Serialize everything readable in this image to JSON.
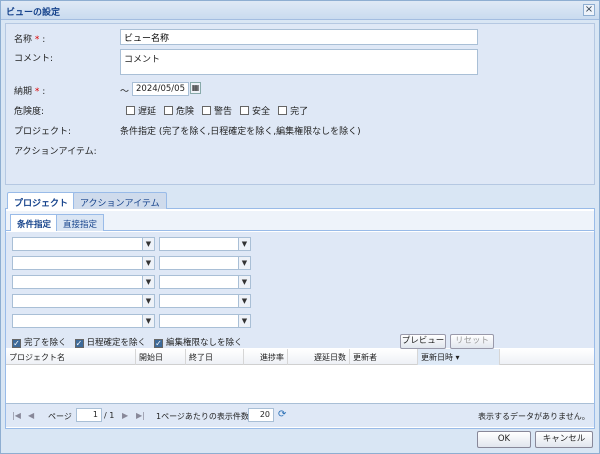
{
  "dialog": {
    "title": "ビューの設定"
  },
  "form": {
    "name_label": "名称",
    "name_value": "ビュー名称",
    "comment_label": "コメント:",
    "comment_value": "コメント",
    "deadline_label": "納期",
    "deadline_prefix": "〜",
    "deadline_value": "2024/05/05",
    "risk_label": "危険度:",
    "risk_options": [
      "遅延",
      "危険",
      "警告",
      "安全",
      "完了"
    ],
    "project_label": "プロジェクト:",
    "project_value": "条件指定 (完了を除く,日程確定を除く,編集権限なしを除く)",
    "action_label": "アクションアイテム:",
    "required_mark": "*",
    "colon": ":"
  },
  "tabs": [
    "プロジェクト",
    "アクションアイテム"
  ],
  "subtabs": [
    "条件指定",
    "直接指定"
  ],
  "filters": {
    "checks": [
      "完了を除く",
      "日程確定を除く",
      "編集権限なしを除く"
    ],
    "preview_button": "プレビュー",
    "reset_button": "リセット"
  },
  "grid": {
    "columns": [
      "プロジェクト名",
      "開始日",
      "終了日",
      "進捗率",
      "遅延日数",
      "更新者",
      "更新日時"
    ],
    "sort_indicator": "▾"
  },
  "pager": {
    "page_label": "ページ",
    "page_value": "1",
    "page_total": "/ 1",
    "per_page_label": "1ページあたりの表示件数",
    "per_page_value": "20",
    "empty_text": "表示するデータがありません。"
  },
  "footer": {
    "ok": "OK",
    "cancel": "キャンセル"
  }
}
